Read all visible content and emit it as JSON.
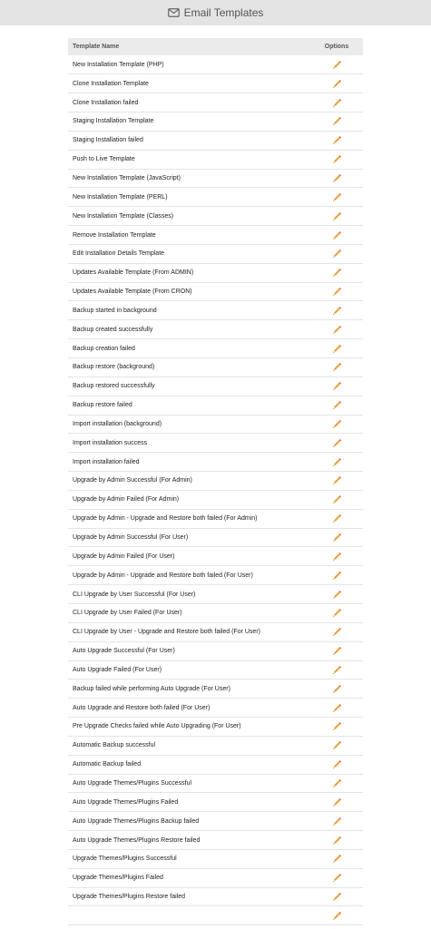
{
  "header": {
    "title": "Email Templates",
    "icon": "envelope-icon"
  },
  "table": {
    "columns": [
      "Template Name",
      "Options"
    ],
    "edit_icon": "pencil-icon",
    "rows": [
      "New Installation Template (PHP)",
      "Clone Installation Template",
      "Clone Installation failed",
      "Staging Installation Template",
      "Staging Installation failed",
      "Push to Live Template",
      "New Installation Template (JavaScript)",
      "New Installation Template (PERL)",
      "New Installation Template (Classes)",
      "Remove Installation Template",
      "Edit Installation Details Template",
      "Updates Available Template (From ADMIN)",
      "Updates Available Template (From CRON)",
      "Backup started in background",
      "Backup created successfully",
      "Backup creation failed",
      "Backup restore (background)",
      "Backup restored successfully",
      "Backup restore failed",
      "Import installation (background)",
      "Import installation success",
      "Import installation failed",
      "Upgrade by Admin Successful (For Admin)",
      "Upgrade by Admin Failed (For Admin)",
      "Upgrade by Admin - Upgrade and Restore both failed (For Admin)",
      "Upgrade by Admin Successful (For User)",
      "Upgrade by Admin Failed (For User)",
      "Upgrade by Admin - Upgrade and Restore both failed (For User)",
      "CLI Upgrade by User Successful (For User)",
      "CLI Upgrade by User Failed (For User)",
      "CLI Upgrade by User - Upgrade and Restore both failed (For User)",
      "Auto Upgrade Successful (For User)",
      "Auto Upgrade Failed (For User)",
      "Backup failed while performing Auto Upgrade (For User)",
      "Auto Upgrade and Restore both failed (For User)",
      "Pre Upgrade Checks failed while Auto Upgrading (For User)",
      "Automatic Backup successful",
      "Automatic Backup failed",
      "Auto Upgrade Themes/Plugins Successful",
      "Auto Upgrade Themes/Plugins Failed",
      "Auto Upgrade Themes/Plugins Backup failed",
      "Auto Upgrade Themes/Plugins Restore failed",
      "Upgrade Themes/Plugins Successful",
      "Upgrade Themes/Plugins Failed",
      "Upgrade Themes/Plugins Restore failed",
      ""
    ]
  },
  "colors": {
    "header_bg": "#e4e4e4",
    "table_header_bg": "#ebebeb",
    "pencil_body": "#e8a23a",
    "pencil_tip": "#444444"
  }
}
